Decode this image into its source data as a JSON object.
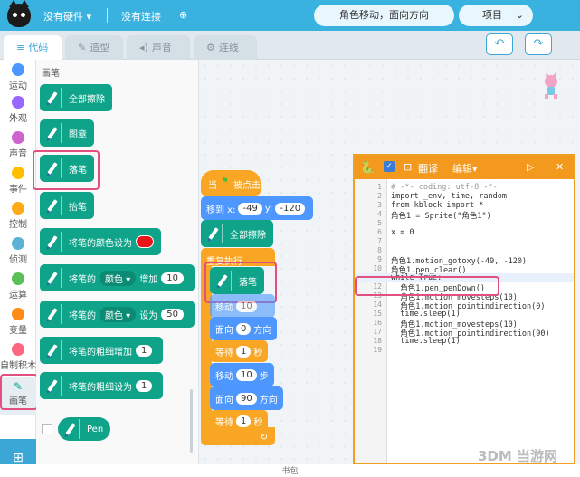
{
  "topbar": {
    "no_hardware": "没有硬件",
    "no_connection": "没有连接",
    "project_title": "角色移动，面向方向",
    "project_button": "项目"
  },
  "tabs": [
    {
      "label": "代码",
      "icon": "code-icon"
    },
    {
      "label": "造型",
      "icon": "brush-icon"
    },
    {
      "label": "声音",
      "icon": "speaker-icon"
    },
    {
      "label": "连线",
      "icon": "wiring-icon"
    }
  ],
  "categories": [
    {
      "label": "运动",
      "color": "#4c97ff"
    },
    {
      "label": "外观",
      "color": "#9966ff"
    },
    {
      "label": "声音",
      "color": "#cf63cf"
    },
    {
      "label": "事件",
      "color": "#ffbf00"
    },
    {
      "label": "控制",
      "color": "#ffab19"
    },
    {
      "label": "侦测",
      "color": "#5cb1d6"
    },
    {
      "label": "运算",
      "color": "#59c059"
    },
    {
      "label": "变量",
      "color": "#ff8c1a"
    },
    {
      "label": "自制积木",
      "color": "#ff6680"
    },
    {
      "label": "画笔",
      "color": "#0fbd8c"
    }
  ],
  "palette": {
    "title": "画笔",
    "blocks": {
      "clear": "全部擦除",
      "stamp": "图章",
      "pen_down": "落笔",
      "pen_up": "抬笔",
      "set_color": "将笔的颜色设为",
      "change_prefix": "将笔的",
      "color_dd": "颜色",
      "change_by": "增加",
      "change_val": "10",
      "set_to": "设为",
      "set_val": "50",
      "size_change": "将笔的粗细增加",
      "size_change_val": "1",
      "size_set": "将笔的粗细设为",
      "size_set_val": "1",
      "ext_label": "Pen"
    }
  },
  "script": {
    "hat_label": "当",
    "hat_suffix": "被点击",
    "goto_label": "移到 x:",
    "goto_x": "-49",
    "goto_y_label": "y:",
    "goto_y": "-120",
    "clear": "全部擦除",
    "repeat": "重复执行",
    "pen_down": "落笔",
    "move1_label": "移动",
    "move1_val": "10",
    "move1_unit": "步",
    "dir1_label": "面向",
    "dir1_val": "0",
    "dir1_unit": "方向",
    "wait1_label": "等待",
    "wait1_val": "1",
    "wait1_unit": "秒",
    "move2_label": "移动",
    "move2_val": "10",
    "move2_unit": "步",
    "dir2_label": "面向",
    "dir2_val": "90",
    "dir2_unit": "方向",
    "wait2_label": "等待",
    "wait2_val": "1",
    "wait2_unit": "秒"
  },
  "code_window": {
    "translate": "翻译",
    "edit": "编辑",
    "lines": [
      "# -*- coding: utf-8 -*-",
      "import _env, time, random",
      "from kblock import *",
      "角色1 = Sprite(\"角色1\")",
      "",
      "x = 0",
      "",
      "",
      "角色1.motion_gotoxy(-49, -120)",
      "角色1.pen_clear()",
      "while True:",
      "  角色1.pen_penDown()",
      "  角色1.motion_movesteps(10)",
      "  角色1.motion_pointindirection(0)",
      "  time.sleep(1)",
      "  角色1.motion_movesteps(10)",
      "  角色1.motion_pointindirection(90)",
      "  time.sleep(1)",
      ""
    ],
    "line_numbers": [
      "1",
      "2",
      "3",
      "4",
      "5",
      "6",
      "7",
      "8",
      "9",
      "10",
      "11",
      "12",
      "13",
      "14",
      "15",
      "16",
      "17",
      "18",
      "19"
    ]
  },
  "status_text": "书包",
  "watermark": "3DM 当游网"
}
